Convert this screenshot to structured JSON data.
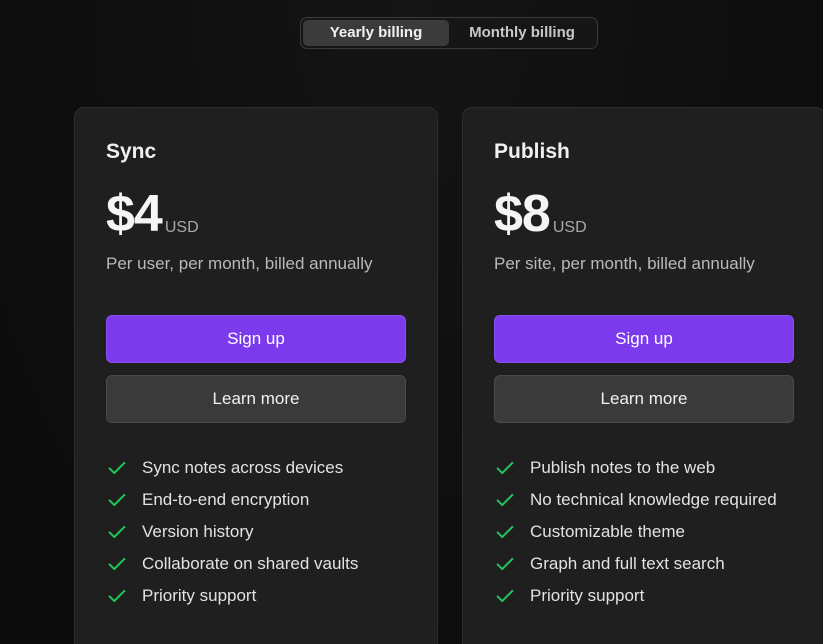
{
  "billing_toggle": {
    "options": [
      "Yearly billing",
      "Monthly billing"
    ],
    "selected": "Yearly billing"
  },
  "plans": [
    {
      "name": "Sync",
      "price": "$4",
      "currency": "USD",
      "price_description": "Per user, per month, billed annually",
      "primary_button": "Sign up",
      "secondary_button": "Learn more",
      "features": [
        "Sync notes across devices",
        "End-to-end encryption",
        "Version history",
        "Collaborate on shared vaults",
        "Priority support"
      ]
    },
    {
      "name": "Publish",
      "price": "$8",
      "currency": "USD",
      "price_description": "Per site, per month, billed annually",
      "primary_button": "Sign up",
      "secondary_button": "Learn more",
      "features": [
        "Publish notes to the web",
        "No technical knowledge required",
        "Customizable theme",
        "Graph and full text search",
        "Priority support"
      ]
    }
  ],
  "colors": {
    "accent": "#7c3aed",
    "check": "#22c55e",
    "card_bg": "#1f1f1f",
    "page_bg": "#0d0d0d"
  },
  "icons": {
    "feature_bullet": "check-icon"
  }
}
